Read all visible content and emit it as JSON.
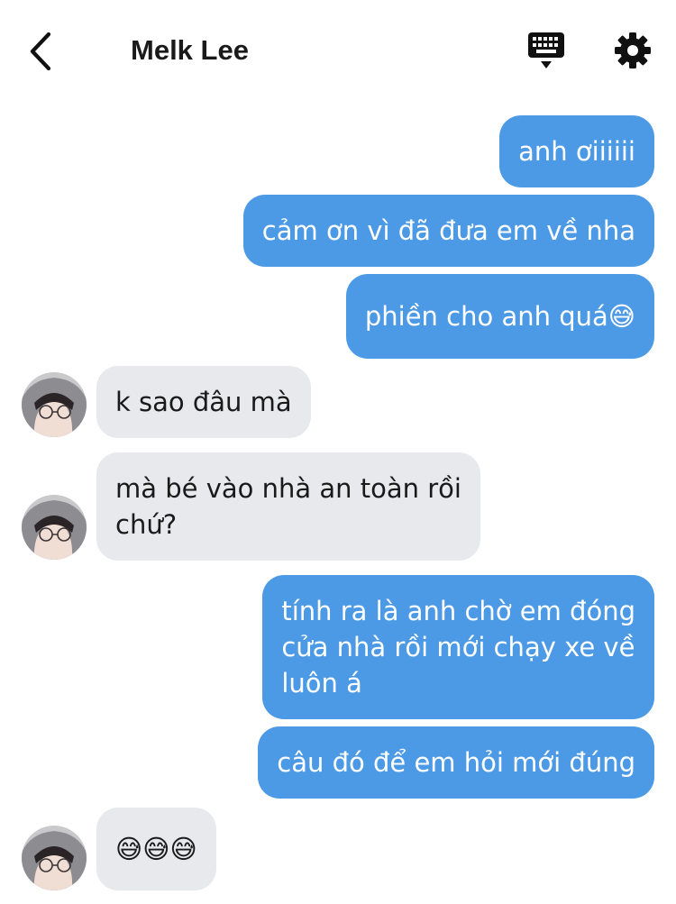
{
  "header": {
    "contact_name": "Melk Lee",
    "icons": [
      "chevron-left-icon",
      "keyboard-icon",
      "gear-icon"
    ]
  },
  "colors": {
    "outgoing_bubble": "#4c9ae6",
    "incoming_bubble": "#e8e9ed",
    "background": "#ffffff"
  },
  "messages": [
    {
      "from": "me",
      "text": "anh ơiiiiii"
    },
    {
      "from": "me",
      "text": "cảm ơn vì đã đưa em về nha"
    },
    {
      "from": "me",
      "text": "phiền cho anh quá😅"
    },
    {
      "from": "Melk Lee",
      "text": "k sao đâu mà"
    },
    {
      "from": "Melk Lee",
      "text": "mà bé vào nhà an toàn rồi\nchứ?"
    },
    {
      "from": "me",
      "text": "tính ra là anh chờ em đóng\ncửa nhà rồi mới chạy xe về\nluôn á"
    },
    {
      "from": "me",
      "text": "câu đó để em hỏi mới đúng"
    },
    {
      "from": "Melk Lee",
      "text": "😅😅😅"
    }
  ]
}
